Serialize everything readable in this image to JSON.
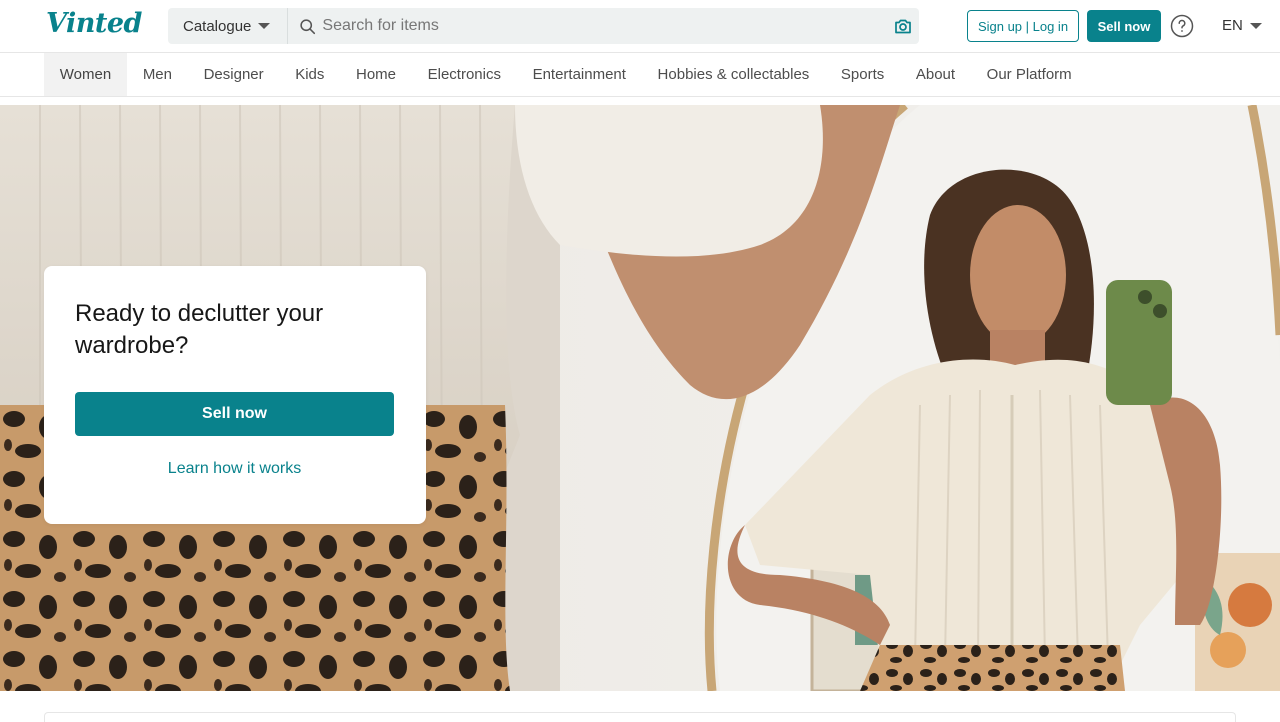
{
  "header": {
    "logo": "Vinted",
    "catalogue_label": "Catalogue",
    "search_placeholder": "Search for items",
    "signup_login_label": "Sign up | Log in",
    "sell_now_label": "Sell now",
    "language": "EN"
  },
  "nav": {
    "items": [
      {
        "label": "Women",
        "active": true
      },
      {
        "label": "Men"
      },
      {
        "label": "Designer"
      },
      {
        "label": "Kids"
      },
      {
        "label": "Home"
      },
      {
        "label": "Electronics"
      },
      {
        "label": "Entertainment"
      },
      {
        "label": "Hobbies & collectables"
      },
      {
        "label": "Sports"
      },
      {
        "label": "About"
      },
      {
        "label": "Our Platform"
      }
    ]
  },
  "hero": {
    "title": "Ready to declutter your wardrobe?",
    "sell_button": "Sell now",
    "learn_link": "Learn how it works"
  },
  "icons": {
    "search": "search-icon",
    "camera": "camera-icon",
    "help": "help-icon",
    "caret": "chevron-down-icon"
  },
  "colors": {
    "brand": "#09828c",
    "search_bg": "#eef1f1",
    "border": "#e6e6e6"
  }
}
